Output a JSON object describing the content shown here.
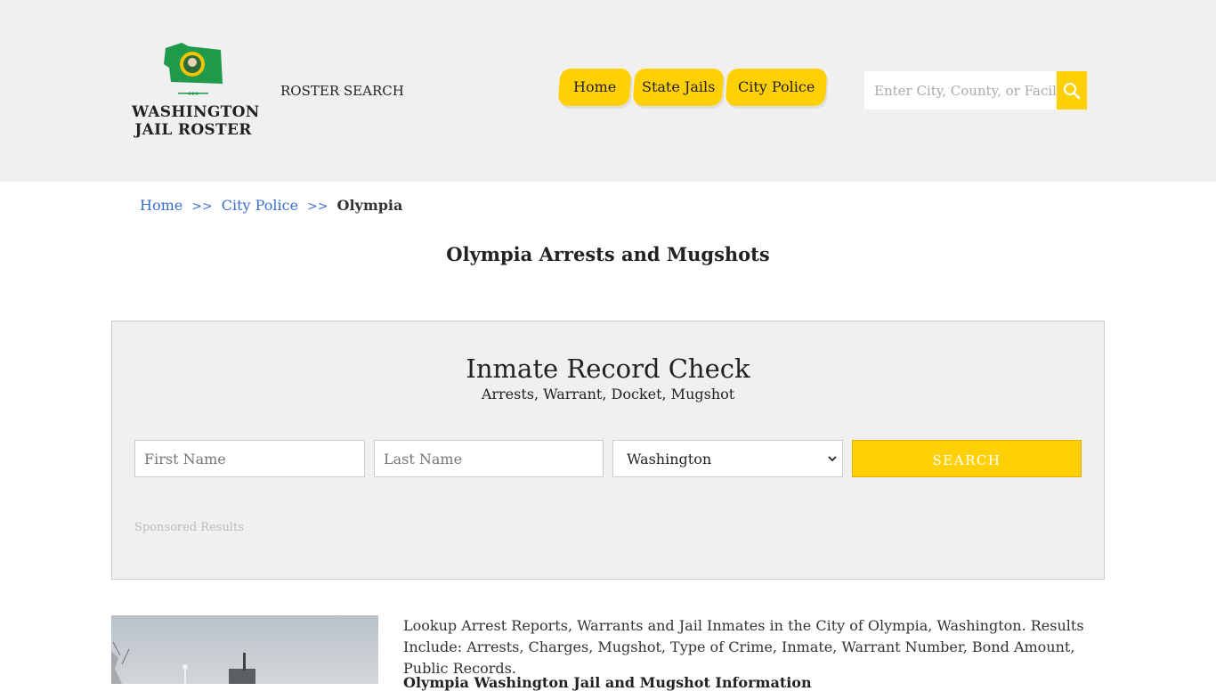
{
  "header": {
    "logo_line1": "WASHINGTON",
    "logo_line2": "JAIL ROSTER",
    "roster_search": "ROSTER SEARCH",
    "nav": [
      {
        "label": "Home"
      },
      {
        "label": "State Jails"
      },
      {
        "label": "City Police"
      }
    ],
    "search_placeholder": "Enter City, County, or Facility"
  },
  "breadcrumb": {
    "home": "Home",
    "sep": ">>",
    "city_police": "City Police",
    "current": "Olympia"
  },
  "page_title": "Olympia Arrests and Mugshots",
  "record_check": {
    "title": "Inmate Record Check",
    "subtitle": "Arrests, Warrant, Docket, Mugshot",
    "first_name_placeholder": "First Name",
    "last_name_placeholder": "Last Name",
    "state_selected": "Washington",
    "search_label": "SEARCH",
    "sponsored": "Sponsored Results"
  },
  "content": {
    "intro": "Lookup Arrest Reports, Warrants and Jail Inmates in the City of Olympia, Washington. Results Include: Arrests, Charges, Mugshot, Type of Crime, Inmate, Warrant Number, Bond Amount, Public Records.",
    "subheading": "Olympia Washington Jail and Mugshot Information"
  },
  "colors": {
    "accent": "#ffd005",
    "header_bg": "#f0f0f0",
    "link": "#3a6fcf"
  }
}
